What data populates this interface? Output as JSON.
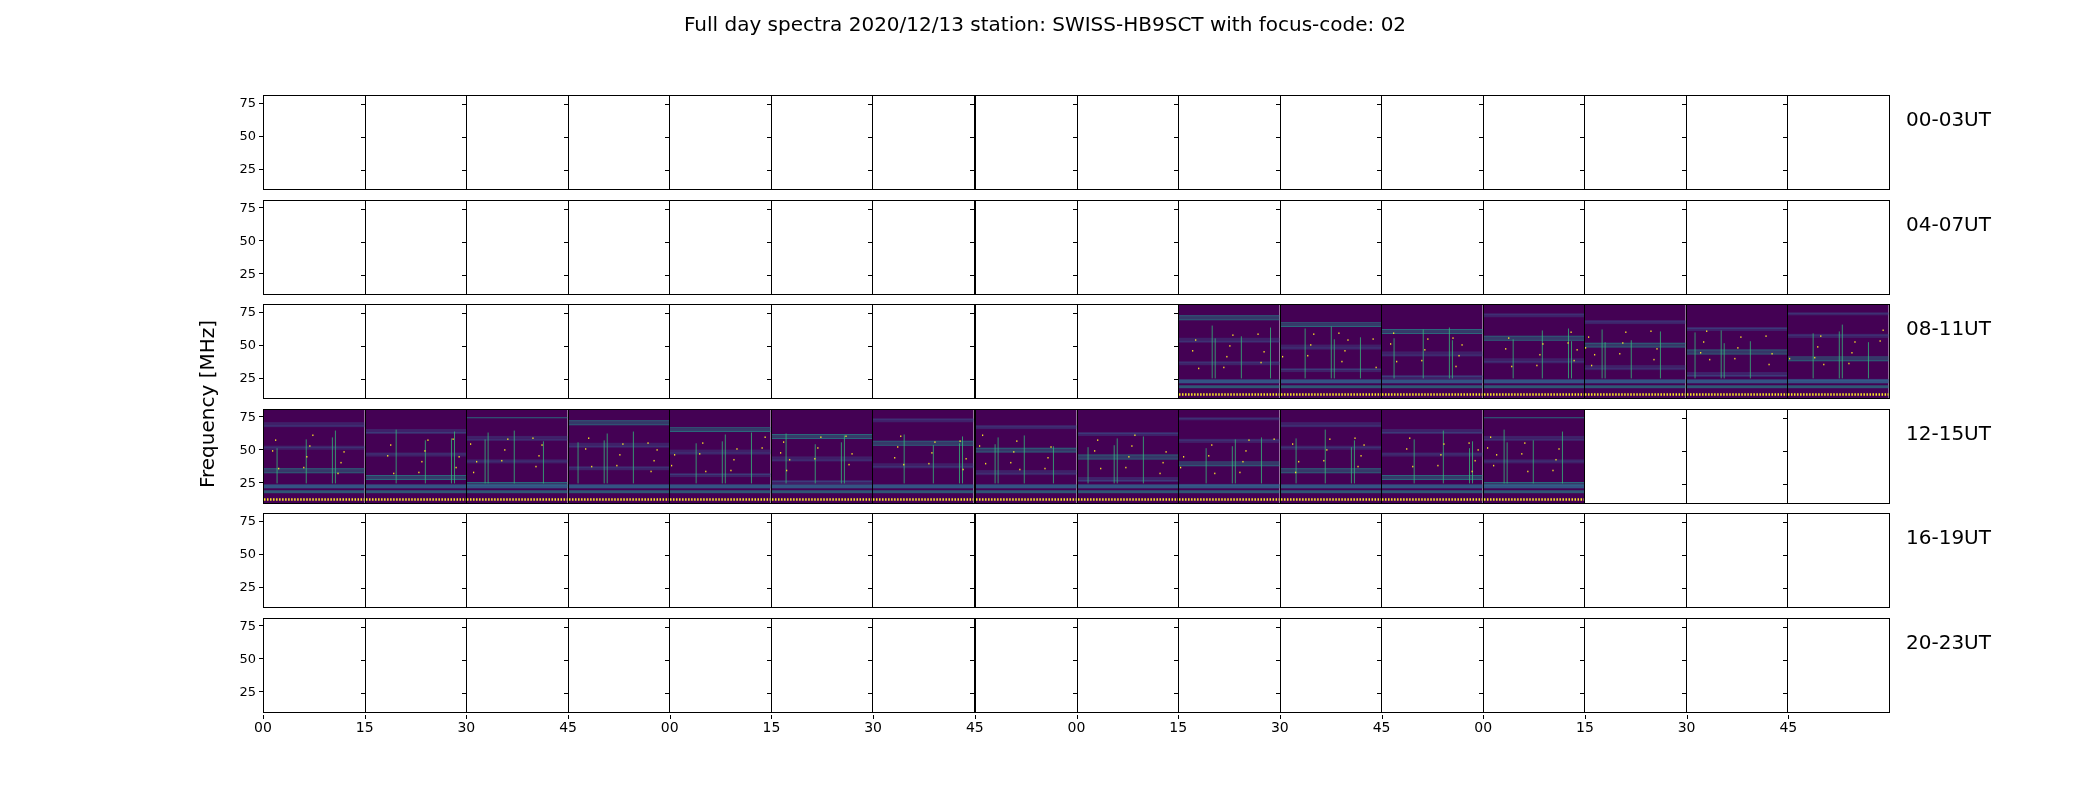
{
  "title": "Full day spectra 2020/12/13 station: SWISS-HB9SCT with focus-code: 02",
  "ylabel": "Frequency [MHz]",
  "rows": [
    {
      "label": "00-03UT",
      "yticks": [
        "75",
        "50",
        "25"
      ],
      "panels": [
        {
          "has_data": false
        },
        {
          "has_data": false
        },
        {
          "has_data": false
        },
        {
          "has_data": false
        },
        {
          "has_data": false
        },
        {
          "has_data": false
        },
        {
          "has_data": false
        },
        {
          "has_data": false
        },
        {
          "has_data": false
        },
        {
          "has_data": false
        },
        {
          "has_data": false
        },
        {
          "has_data": false
        },
        {
          "has_data": false
        },
        {
          "has_data": false
        },
        {
          "has_data": false
        },
        {
          "has_data": false
        }
      ]
    },
    {
      "label": "04-07UT",
      "yticks": [
        "75",
        "50",
        "25"
      ],
      "panels": [
        {
          "has_data": false
        },
        {
          "has_data": false
        },
        {
          "has_data": false
        },
        {
          "has_data": false
        },
        {
          "has_data": false
        },
        {
          "has_data": false
        },
        {
          "has_data": false
        },
        {
          "has_data": false
        },
        {
          "has_data": false
        },
        {
          "has_data": false
        },
        {
          "has_data": false
        },
        {
          "has_data": false
        },
        {
          "has_data": false
        },
        {
          "has_data": false
        },
        {
          "has_data": false
        },
        {
          "has_data": false
        }
      ]
    },
    {
      "label": "08-11UT",
      "yticks": [
        "75",
        "50",
        "25"
      ],
      "panels": [
        {
          "has_data": false
        },
        {
          "has_data": false
        },
        {
          "has_data": false
        },
        {
          "has_data": false
        },
        {
          "has_data": false
        },
        {
          "has_data": false
        },
        {
          "has_data": false
        },
        {
          "has_data": false
        },
        {
          "has_data": false
        },
        {
          "has_data": true
        },
        {
          "has_data": true
        },
        {
          "has_data": true
        },
        {
          "has_data": true
        },
        {
          "has_data": true
        },
        {
          "has_data": true
        },
        {
          "has_data": true
        }
      ]
    },
    {
      "label": "12-15UT",
      "yticks": [
        "75",
        "50",
        "25"
      ],
      "panels": [
        {
          "has_data": true
        },
        {
          "has_data": true
        },
        {
          "has_data": true
        },
        {
          "has_data": true
        },
        {
          "has_data": true
        },
        {
          "has_data": true
        },
        {
          "has_data": true
        },
        {
          "has_data": true
        },
        {
          "has_data": true
        },
        {
          "has_data": true
        },
        {
          "has_data": true
        },
        {
          "has_data": true
        },
        {
          "has_data": true
        },
        {
          "has_data": false
        },
        {
          "has_data": false
        },
        {
          "has_data": false
        }
      ]
    },
    {
      "label": "16-19UT",
      "yticks": [
        "75",
        "50",
        "25"
      ],
      "panels": [
        {
          "has_data": false
        },
        {
          "has_data": false
        },
        {
          "has_data": false
        },
        {
          "has_data": false
        },
        {
          "has_data": false
        },
        {
          "has_data": false
        },
        {
          "has_data": false
        },
        {
          "has_data": false
        },
        {
          "has_data": false
        },
        {
          "has_data": false
        },
        {
          "has_data": false
        },
        {
          "has_data": false
        },
        {
          "has_data": false
        },
        {
          "has_data": false
        },
        {
          "has_data": false
        },
        {
          "has_data": false
        }
      ]
    },
    {
      "label": "20-23UT",
      "yticks": [
        "75",
        "50",
        "25"
      ],
      "panels": [
        {
          "has_data": false
        },
        {
          "has_data": false
        },
        {
          "has_data": false
        },
        {
          "has_data": false
        },
        {
          "has_data": false
        },
        {
          "has_data": false
        },
        {
          "has_data": false
        },
        {
          "has_data": false
        },
        {
          "has_data": false
        },
        {
          "has_data": false
        },
        {
          "has_data": false
        },
        {
          "has_data": false
        },
        {
          "has_data": false
        },
        {
          "has_data": false
        },
        {
          "has_data": false
        },
        {
          "has_data": false
        }
      ]
    }
  ],
  "xticks": [
    "00",
    "15",
    "30",
    "45",
    "00",
    "15",
    "30",
    "45",
    "00",
    "15",
    "30",
    "45",
    "00",
    "15",
    "30",
    "45"
  ]
}
